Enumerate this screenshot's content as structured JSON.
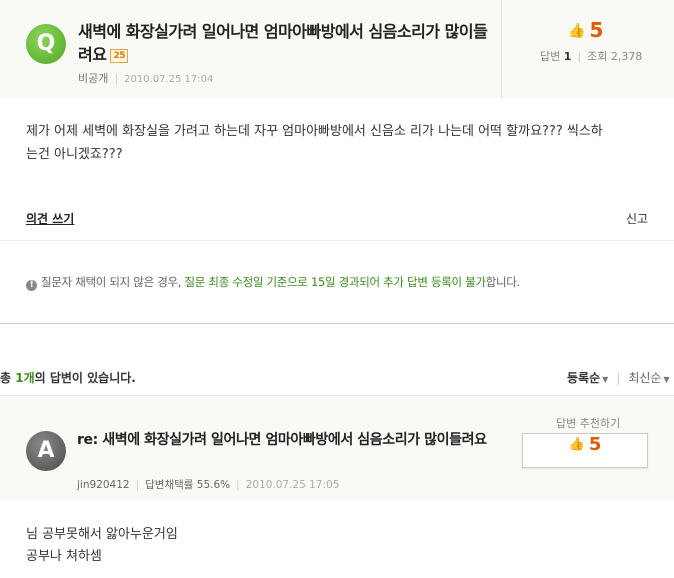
{
  "question": {
    "badge": "Q",
    "title": "새벽에 화장실가려 일어나면 엄마아빠방에서 심음소리가 많이들려요",
    "level": "25",
    "author": "비공개",
    "date": "2010.07.25 17:04",
    "likes": "5",
    "answers_label": "답변",
    "answers_count": "1",
    "views_label": "조회",
    "views_count": "2,378",
    "body_line1": "제가 어제 세벽에 화장실을 가려고 하는데 자꾸 엄마아빠방에서 신음소 리가 나는데 어떡 할까요??? 씩스하",
    "body_line2": "는건 아니겠죠???",
    "comment_label": "의견 쓰기",
    "report_label": "신고",
    "notice_prefix": "질문자 채택이 되지 않은 경우,",
    "notice_highlight": "질문 최종 수정일 기준으로 15일 경과되어 추가 답변 등록이 불가",
    "notice_suffix": "합니다."
  },
  "answers_summary": {
    "prefix": "총",
    "count": "1개",
    "suffix": "의 답변이 있습니다.",
    "sort_active": "등록순",
    "sort_other": "최신순"
  },
  "answer": {
    "avatar": "A",
    "title": "re: 새벽에 화장실가려 일어나면 엄마아빠방에서 심음소리가 많이들려요",
    "author": "jin920412",
    "adoption_rate": "답변채택률 55.6%",
    "date": "2010.07.25 17:05",
    "recommend_label": "답변 추천하기",
    "recommend_count": "5",
    "body_line1": "님 공부못해서 앓아누운거임",
    "body_line2": "공부나 쳐하셈"
  },
  "colors": {
    "accent_green": "#3d8a1f",
    "like_orange": "#e05a00",
    "q_badge": "#6cbf3c",
    "header_bg": "#f9f9f6"
  },
  "icons": {
    "like": "thumbs-up-icon",
    "notice": "exclamation-icon",
    "sort": "caret-down-icon"
  }
}
